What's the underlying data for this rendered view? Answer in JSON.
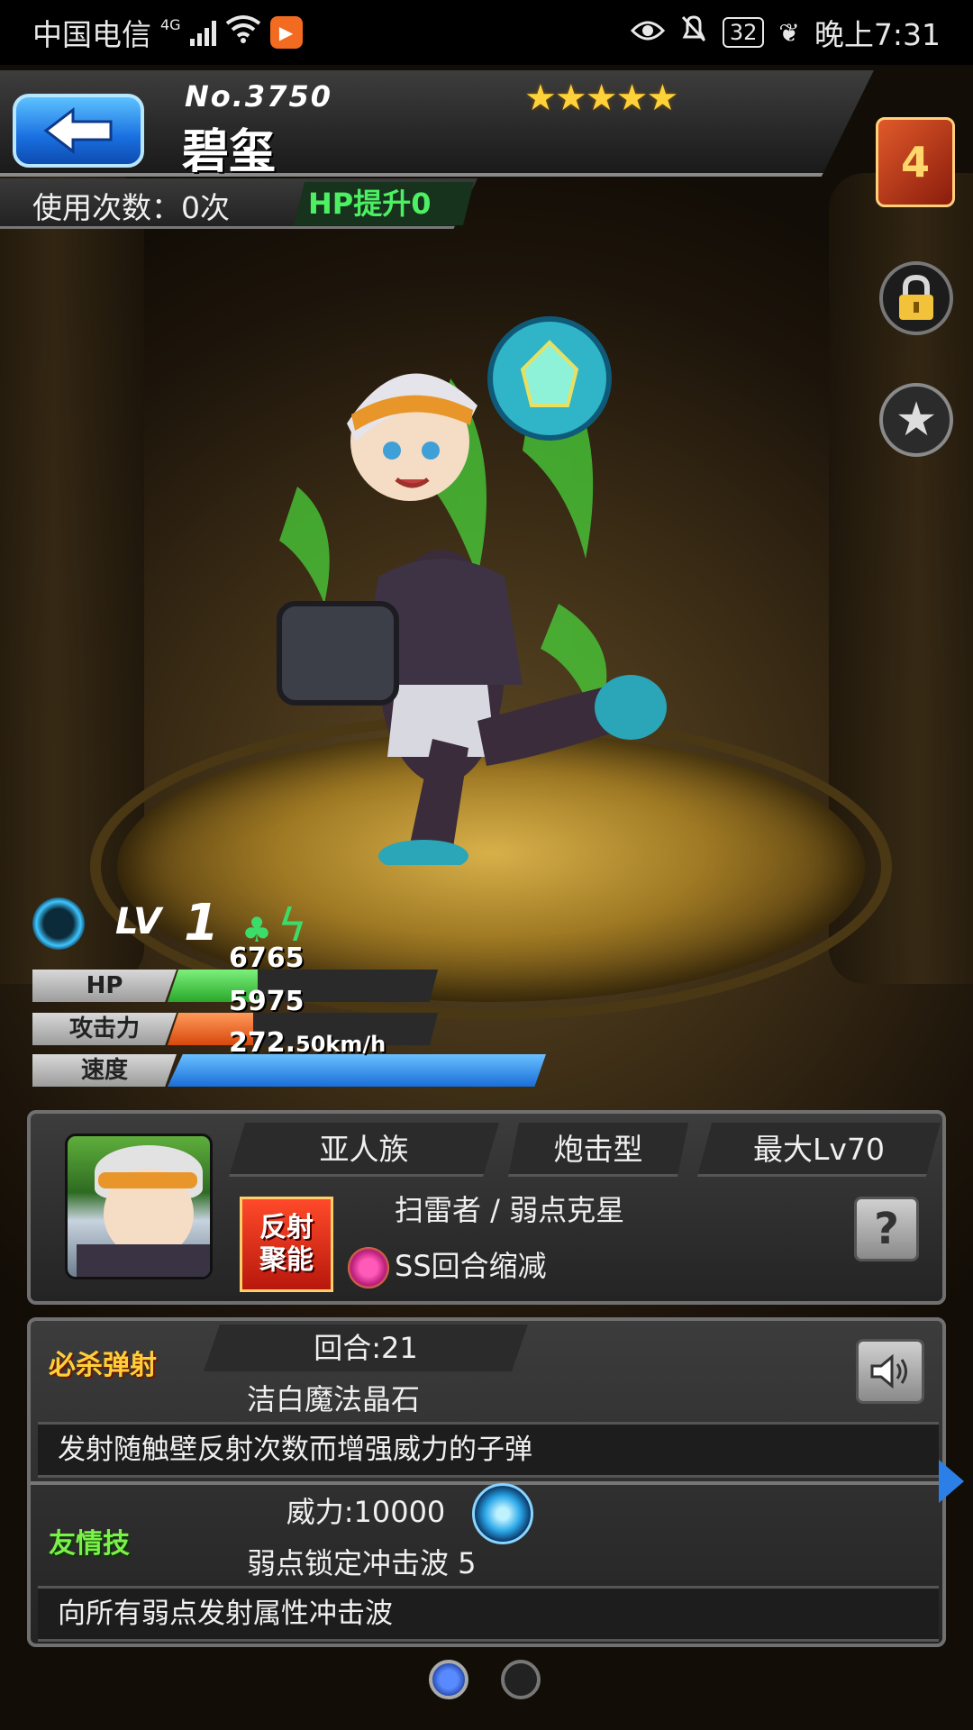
{
  "status_bar": {
    "carrier": "中国电信",
    "network": "4G",
    "battery": "32",
    "time": "晚上7:31"
  },
  "header": {
    "monster_no": "No.3750",
    "monster_name": "碧玺",
    "rarity_stars": "★★★★★",
    "usage_label": "使用次数：0次",
    "hp_bonus": "HP提升0"
  },
  "side_buttons": {
    "book_glyph": "4"
  },
  "stats": {
    "level_label": "LV",
    "level": "1",
    "hp_label": "HP",
    "hp_value": "6765",
    "atk_label": "攻击力",
    "atk_value": "5975",
    "speed_label": "速度",
    "speed_value": "272.",
    "speed_decimal": "50km/h",
    "colors": {
      "hp": "#3cc43c",
      "atk": "#e85a1c",
      "speed": "#2b8ee8"
    }
  },
  "info": {
    "race": "亚人族",
    "type": "炮击型",
    "max_level": "最大Lv70",
    "ability_icon_top": "反射",
    "ability_icon_bottom": "聚能",
    "abilities": "扫雷者 / 弱点克星",
    "gauge": "SS回合缩减",
    "help": "?"
  },
  "skills": {
    "strike_label": "必杀弹射",
    "strike_turns": "回合:21",
    "strike_name": "洁白魔法晶石",
    "strike_desc": "发射随触壁反射次数而增强威力的子弹",
    "friend_label": "友情技",
    "friend_power": "威力:10000",
    "friend_name": "弱点锁定冲击波 5",
    "friend_desc": "向所有弱点发射属性冲击波"
  }
}
